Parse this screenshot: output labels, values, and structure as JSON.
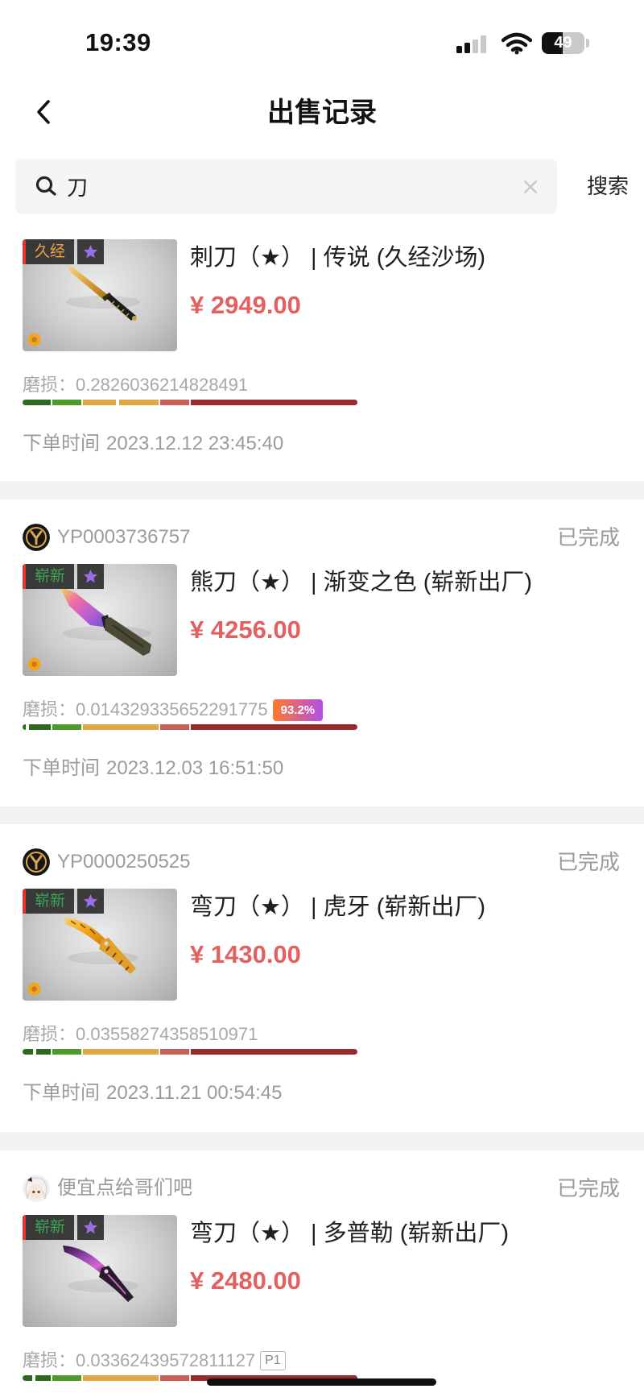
{
  "status_bar": {
    "time": "19:39",
    "battery": "49"
  },
  "header": {
    "title": "出售记录",
    "back_icon": "chevron-left-icon"
  },
  "search": {
    "value": "刀",
    "button_label": "搜索",
    "icon": "search-icon",
    "clear_icon": "close-icon"
  },
  "colors": {
    "price": "#e45f5f",
    "muted_text": "#9b9b9b",
    "grade_field_tested": "#ee9f45",
    "grade_factory_new": "#3aa552",
    "star_badge": "#9b6ee6"
  },
  "orders": [
    {
      "grade_badge": "久经",
      "title": "刺刀（★） | 传说 (久经沙场)",
      "price": "¥ 2949.00",
      "wear_label": "磨损：",
      "wear_value": "0.2826036214828491",
      "order_time_label": "下单时间",
      "order_time": "2023.12.12 23:45:40"
    },
    {
      "seller": "YP0003736757",
      "status": "已完成",
      "grade_badge": "崭新",
      "title": "熊刀（★） | 渐变之色 (崭新出厂)",
      "price": "¥ 4256.00",
      "wear_label": "磨损：",
      "wear_value": "0.014329335652291775",
      "wear_badge": "93.2%",
      "order_time_label": "下单时间",
      "order_time": "2023.12.03 16:51:50"
    },
    {
      "seller": "YP0000250525",
      "status": "已完成",
      "grade_badge": "崭新",
      "title": "弯刀（★） | 虎牙 (崭新出厂)",
      "price": "¥ 1430.00",
      "wear_label": "磨损：",
      "wear_value": "0.03558274358510971",
      "order_time_label": "下单时间",
      "order_time": "2023.11.21 00:54:45"
    },
    {
      "seller": "便宜点给哥们吧",
      "status": "已完成",
      "grade_badge": "崭新",
      "title": "弯刀（★） | 多普勒 (崭新出厂)",
      "price": "¥ 2480.00",
      "wear_label": "磨损：",
      "wear_value": "0.03362439572811127",
      "wear_badge": "P1"
    }
  ]
}
